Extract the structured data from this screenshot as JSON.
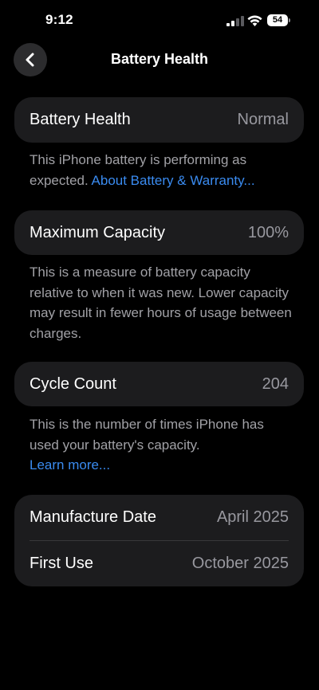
{
  "status_bar": {
    "time": "9:12",
    "battery_level": "54"
  },
  "nav": {
    "title": "Battery Health",
    "back_icon": "chevron-left-icon"
  },
  "battery_health": {
    "label": "Battery Health",
    "value": "Normal",
    "description": "This iPhone battery is performing as expected.",
    "link": "About Battery & Warranty..."
  },
  "maximum_capacity": {
    "label": "Maximum Capacity",
    "value": "100%",
    "description": "This is a measure of battery capacity relative to when it was new. Lower capacity may result in fewer hours of usage between charges."
  },
  "cycle_count": {
    "label": "Cycle Count",
    "value": "204",
    "description": "This is the number of times iPhone has used your battery's capacity.",
    "link": "Learn more..."
  },
  "dates": {
    "manufacture_label": "Manufacture Date",
    "manufacture_value": "April 2025",
    "first_use_label": "First Use",
    "first_use_value": "October 2025"
  },
  "colors": {
    "background": "#000000",
    "card": "#1c1c1e",
    "secondary_text": "#98989f",
    "link": "#3a8bf0"
  }
}
